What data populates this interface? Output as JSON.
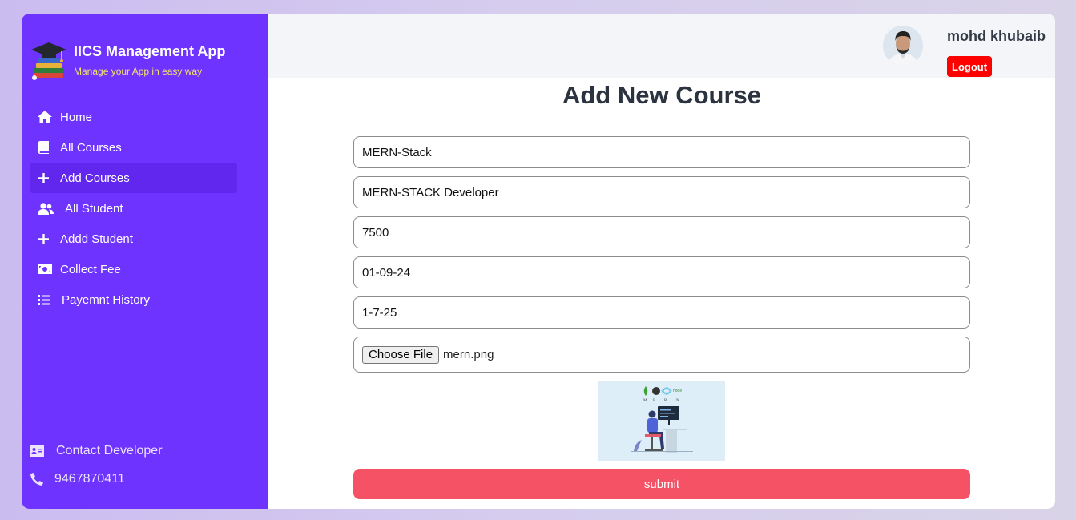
{
  "brand": {
    "title": "IICS Management App",
    "subtitle": "Manage your App in easy way"
  },
  "sidebar": {
    "items": [
      {
        "label": "Home",
        "icon": "home-icon"
      },
      {
        "label": "All Courses",
        "icon": "book-icon"
      },
      {
        "label": "Add Courses",
        "icon": "plus-icon",
        "active": true
      },
      {
        "label": "All Student",
        "icon": "users-icon"
      },
      {
        "label": "Addd Student",
        "icon": "plus-icon"
      },
      {
        "label": "Collect Fee",
        "icon": "money-bill-icon"
      },
      {
        "label": "Payemnt History",
        "icon": "list-icon"
      }
    ],
    "footer": {
      "contact_label": "Contact Developer",
      "phone": "9467870411"
    }
  },
  "header": {
    "user_name": "mohd khubaib",
    "logout_label": "Logout"
  },
  "form": {
    "title": "Add New Course",
    "course_name": "MERN-Stack",
    "description": "MERN-STACK Developer",
    "price": "7500",
    "start_date": "01-09-24",
    "end_date": "1-7-25",
    "file_button_label": "Choose File",
    "file_name": "mern.png",
    "preview_letters": [
      "M",
      "E",
      "R",
      "N"
    ],
    "preview_node_label": "node",
    "submit_label": "submit"
  },
  "colors": {
    "sidebar_bg": "#6e33ff",
    "active_item_bg": "#6127ee",
    "logout_bg": "#ff0000",
    "submit_bg": "#f65266",
    "brand_subtitle": "#f4e26c"
  }
}
